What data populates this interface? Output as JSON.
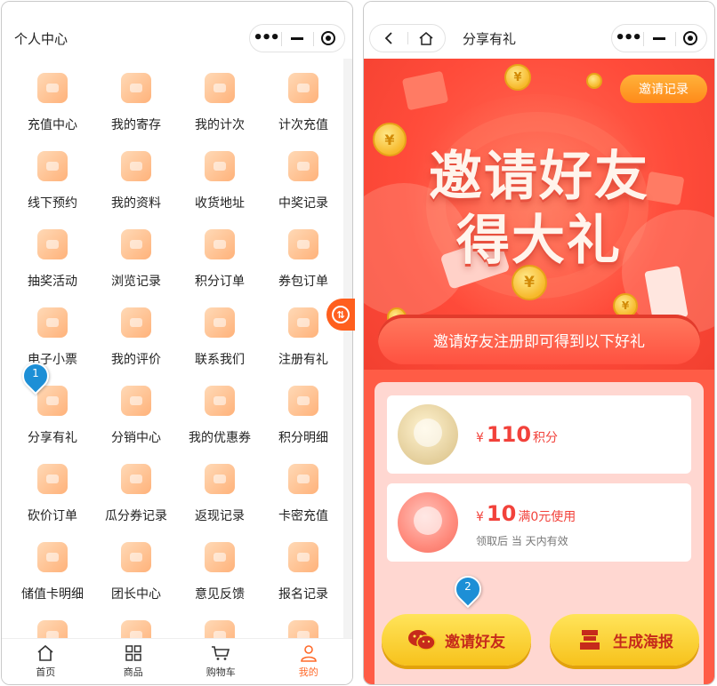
{
  "left": {
    "title": "个人中心",
    "menu": [
      "充值中心",
      "我的寄存",
      "我的计次",
      "计次充值",
      "线下预约",
      "我的资料",
      "收货地址",
      "中奖记录",
      "抽奖活动",
      "浏览记录",
      "积分订单",
      "券包订单",
      "电子小票",
      "我的评价",
      "联系我们",
      "注册有礼",
      "分享有礼",
      "分销中心",
      "我的优惠券",
      "积分明细",
      "砍价订单",
      "瓜分券记录",
      "返现记录",
      "卡密充值",
      "储值卡明细",
      "团长中心",
      "意见反馈",
      "报名记录",
      "",
      "",
      "",
      ""
    ],
    "tabs": [
      {
        "label": "首页",
        "icon": "home-icon"
      },
      {
        "label": "商品",
        "icon": "grid-icon"
      },
      {
        "label": "购物车",
        "icon": "cart-icon"
      },
      {
        "label": "我的",
        "icon": "user-icon"
      }
    ],
    "active_tab": 3,
    "marker": "1"
  },
  "right": {
    "title": "分享有礼",
    "invite_record": "邀请记录",
    "hero_line1": "邀请好友",
    "hero_line2": "得大礼",
    "ribbon": "邀请好友注册即可得到以下好礼",
    "reward1": {
      "yen": "¥",
      "amount": "110",
      "unit": "积分"
    },
    "reward2": {
      "yen": "¥",
      "amount": "10",
      "unit": "满0元使用",
      "note": "领取后 当 天内有效"
    },
    "invite_button": "邀请好友",
    "poster_button": "生成海报",
    "marker": "2"
  },
  "colors": {
    "accent": "#ff6a2a",
    "hero_red": "#ff4b3a",
    "price_red": "#f2423b",
    "button_yellow": "#f7c21c",
    "marker_blue": "#1d8fd6"
  }
}
